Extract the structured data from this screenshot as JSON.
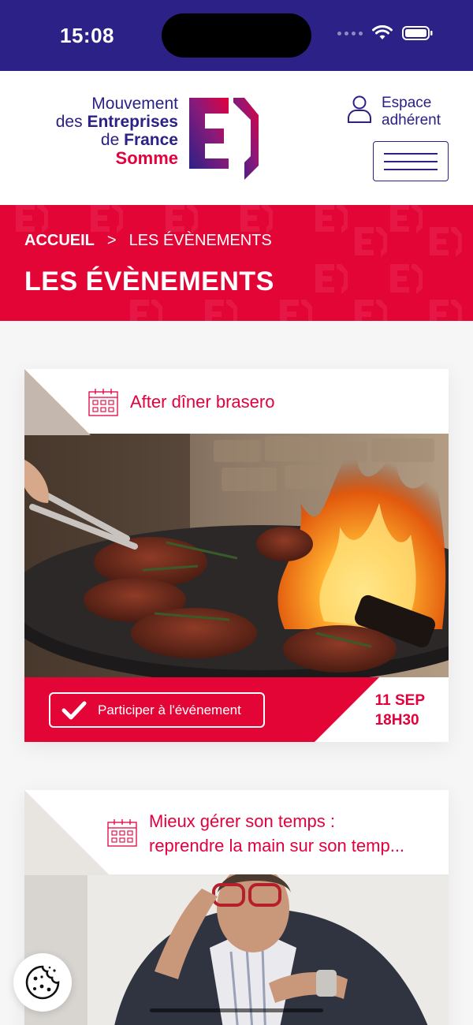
{
  "status_bar": {
    "time": "15:08"
  },
  "header": {
    "logo": {
      "line1": "Mouvement",
      "line2_prefix": "des ",
      "line2_bold": "Entreprises",
      "line3_prefix": "de ",
      "line3_bold": "France",
      "line4": "Somme",
      "mark_letter": "E"
    },
    "account": {
      "line1": "Espace",
      "line2": "adhérent",
      "icon": "user-icon"
    },
    "menu_icon": "hamburger-icon"
  },
  "hero": {
    "breadcrumb": {
      "home": "ACCUEIL",
      "separator": ">",
      "current": "LES ÉVÈNEMENTS"
    },
    "title": "LES ÉVÈNEMENTS"
  },
  "events": [
    {
      "title": "After dîner brasero",
      "button_label": "Participer à l'événement",
      "date_line1": "11 SEP",
      "date_line2": "18H30",
      "icon": "calendar-icon",
      "image": "grilled-steaks-brasero-photo"
    },
    {
      "title_line1": "Mieux gérer son temps :",
      "title_line2": "reprendre la main sur son temp...",
      "icon": "calendar-icon",
      "image": "man-checking-watch-photo"
    }
  ],
  "cookie_icon": "cookie-icon",
  "colors": {
    "navy": "#2b2186",
    "red": "#e40537",
    "brand_red": "#e2003d"
  }
}
